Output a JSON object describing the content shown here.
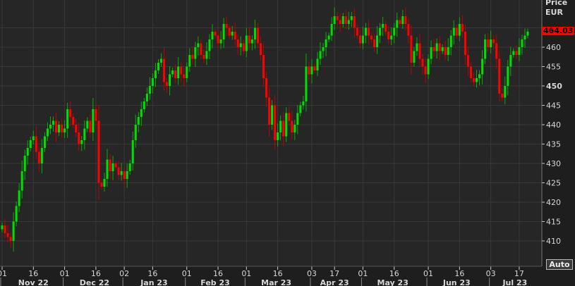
{
  "chart_data": {
    "type": "candlestick",
    "currency_label": "EUR",
    "price_label": "Price",
    "last_price": "464.03",
    "first_open": 413,
    "ylim": [
      404,
      472
    ],
    "y_ticks": [
      410,
      415,
      420,
      425,
      430,
      435,
      440,
      445,
      450,
      455,
      460,
      465
    ],
    "y_tick_labels": [
      "410",
      "415",
      "420",
      "425",
      "430",
      "435",
      "440",
      "445",
      "450",
      "455",
      "460",
      "465"
    ],
    "x_day_ticks": [
      {
        "label": "01",
        "index": 0
      },
      {
        "label": "16",
        "index": 11
      },
      {
        "label": "01",
        "index": 22
      },
      {
        "label": "16",
        "index": 33
      },
      {
        "label": "02",
        "index": 43
      },
      {
        "label": "16",
        "index": 53
      },
      {
        "label": "01",
        "index": 65
      },
      {
        "label": "16",
        "index": 76
      },
      {
        "label": "01",
        "index": 86
      },
      {
        "label": "16",
        "index": 97
      },
      {
        "label": "03",
        "index": 109
      },
      {
        "label": "17",
        "index": 117
      },
      {
        "label": "01",
        "index": 127
      },
      {
        "label": "16",
        "index": 138
      },
      {
        "label": "01",
        "index": 150
      },
      {
        "label": "16",
        "index": 161
      },
      {
        "label": "03",
        "index": 172
      },
      {
        "label": "17",
        "index": 182
      }
    ],
    "x_month_labels": [
      {
        "label": "Nov 22",
        "index": 11
      },
      {
        "label": "Dec 22",
        "index": 32.5
      },
      {
        "label": "Jan 23",
        "index": 53.5
      },
      {
        "label": "Feb 23",
        "index": 75
      },
      {
        "label": "Mar 23",
        "index": 96.5
      },
      {
        "label": "Apr 23",
        "index": 117
      },
      {
        "label": "May 23",
        "index": 137.5
      },
      {
        "label": "Jun 23",
        "index": 160
      },
      {
        "label": "Jul 23",
        "index": 180.5
      }
    ],
    "month_starts": [
      0,
      22,
      43,
      65,
      86,
      109,
      127,
      150,
      172
    ],
    "close": [
      414,
      412,
      411,
      410,
      415,
      419,
      423,
      428,
      432,
      434,
      436,
      437,
      433,
      430,
      434,
      437,
      439,
      440,
      441,
      438,
      440,
      438,
      439,
      444,
      442,
      440,
      438,
      435,
      436,
      439,
      441,
      438,
      444,
      441,
      425,
      424,
      426,
      431,
      428,
      430,
      429,
      427,
      428,
      426,
      428,
      430,
      436,
      440,
      442,
      444,
      446,
      448,
      450,
      452,
      454,
      456,
      457,
      451,
      450,
      453,
      454,
      452,
      455,
      453,
      452,
      455,
      458,
      457,
      460,
      461,
      458,
      457,
      459,
      462,
      464,
      463,
      461,
      462,
      466,
      465,
      463,
      464,
      462,
      460,
      461,
      459,
      463,
      461,
      462,
      465,
      461,
      458,
      452,
      447,
      440,
      445,
      436,
      438,
      441,
      437,
      443,
      441,
      438,
      440,
      443,
      445,
      446,
      455,
      453,
      455,
      454,
      457,
      459,
      460,
      462,
      463,
      466,
      468,
      467,
      466,
      468,
      466,
      467,
      468,
      465,
      463,
      461,
      463,
      465,
      463,
      462,
      460,
      463,
      465,
      466,
      464,
      462,
      463,
      465,
      467,
      466,
      468,
      466,
      463,
      456,
      459,
      461,
      457,
      455,
      453,
      457,
      460,
      459,
      461,
      459,
      460,
      458,
      460,
      463,
      465,
      463,
      466,
      464,
      458,
      455,
      452,
      451,
      452,
      453,
      457,
      462,
      460,
      462,
      461,
      457,
      448,
      447,
      450,
      455,
      458,
      459,
      458,
      460,
      462,
      463,
      464.03
    ],
    "colors": {
      "up": "#00e000",
      "down": "#ff0000",
      "background": "#262626",
      "grid": "#383838"
    }
  },
  "controls": {
    "auto_label": "Auto"
  }
}
